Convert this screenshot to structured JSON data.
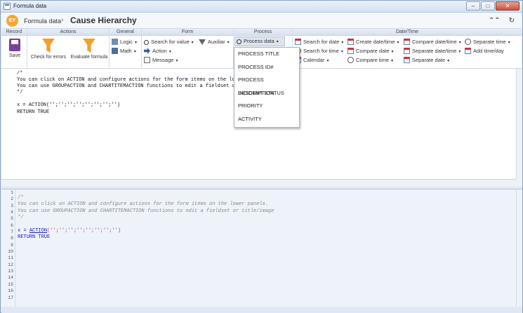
{
  "window": {
    "title": "Formula data",
    "btn_min": "–",
    "btn_max": "□",
    "btn_close": "✕"
  },
  "header": {
    "logo": "EY",
    "breadcrumb_parent": "Formula data",
    "separator": "›",
    "title": "Cause Hierarchy",
    "collapse_icon": "⌃⌃",
    "refresh_icon": "↻"
  },
  "ribbon": {
    "groups": {
      "record": "Record",
      "actions": "Actions",
      "general": "General",
      "form": "Form",
      "process": "Process",
      "datetime": "Date/Time"
    },
    "record": {
      "save": "Save"
    },
    "actions": {
      "check": "Check for errors",
      "evaluate": "Evaluate formula"
    },
    "general": {
      "logic": "Logic",
      "math": "Math"
    },
    "form": {
      "search_value": "Search for value",
      "auxiliar": "Auxiliar",
      "action": "Action",
      "message": "Message"
    },
    "process": {
      "process_data": "Process data"
    },
    "datetime": {
      "search_date": "Search for date",
      "search_time": "Search for time",
      "calendar": "Calendar",
      "create_datetime": "Create date/time",
      "compare_date": "Compare date",
      "compare_time": "Compare time",
      "compare_datetime": "Compare date/time",
      "separate_datetime": "Separate date/time",
      "separate_date": "Separate date",
      "separate_time": "Separate time",
      "add_timeday": "Add time/day"
    },
    "dropdown_glyph": "▾"
  },
  "process_menu": [
    "PROCESS TITLE",
    "PROCESS ID#",
    "PROCESS DESCRIPTION",
    "INCIDENT STATUS",
    "PRIORITY",
    "ACTIVITY"
  ],
  "editor_top": {
    "text": "/*\nYou can click on ACTION and configure actions for the form items on the lower p\nYou can use GROUPACTION and CHARTITEMACTION functions to edit a fieldset or titl\n*/\n\nx = ACTION('';'';'';'';'';'';'';'')\nRETURN TRUE"
  },
  "editor_bottom": {
    "line_numbers": [
      "1",
      "2",
      "3",
      "4",
      "5",
      "6",
      "7",
      "8",
      "9",
      "10",
      "11",
      "12",
      "13",
      "14",
      "15",
      "16",
      "17"
    ],
    "comment_open": "/*",
    "comment_line1": "You can click on ACTION and configure actions for the form items on the lower panels.",
    "comment_line2": "You can use GROUPACTION and CHARTITEMACTION functions to edit a fieldset or title/image",
    "comment_close": "*/",
    "assign": "x = ",
    "func": "ACTION",
    "args": "('';'';'';'';'';'';'';'')",
    "ret": "RETURN TRUE"
  }
}
